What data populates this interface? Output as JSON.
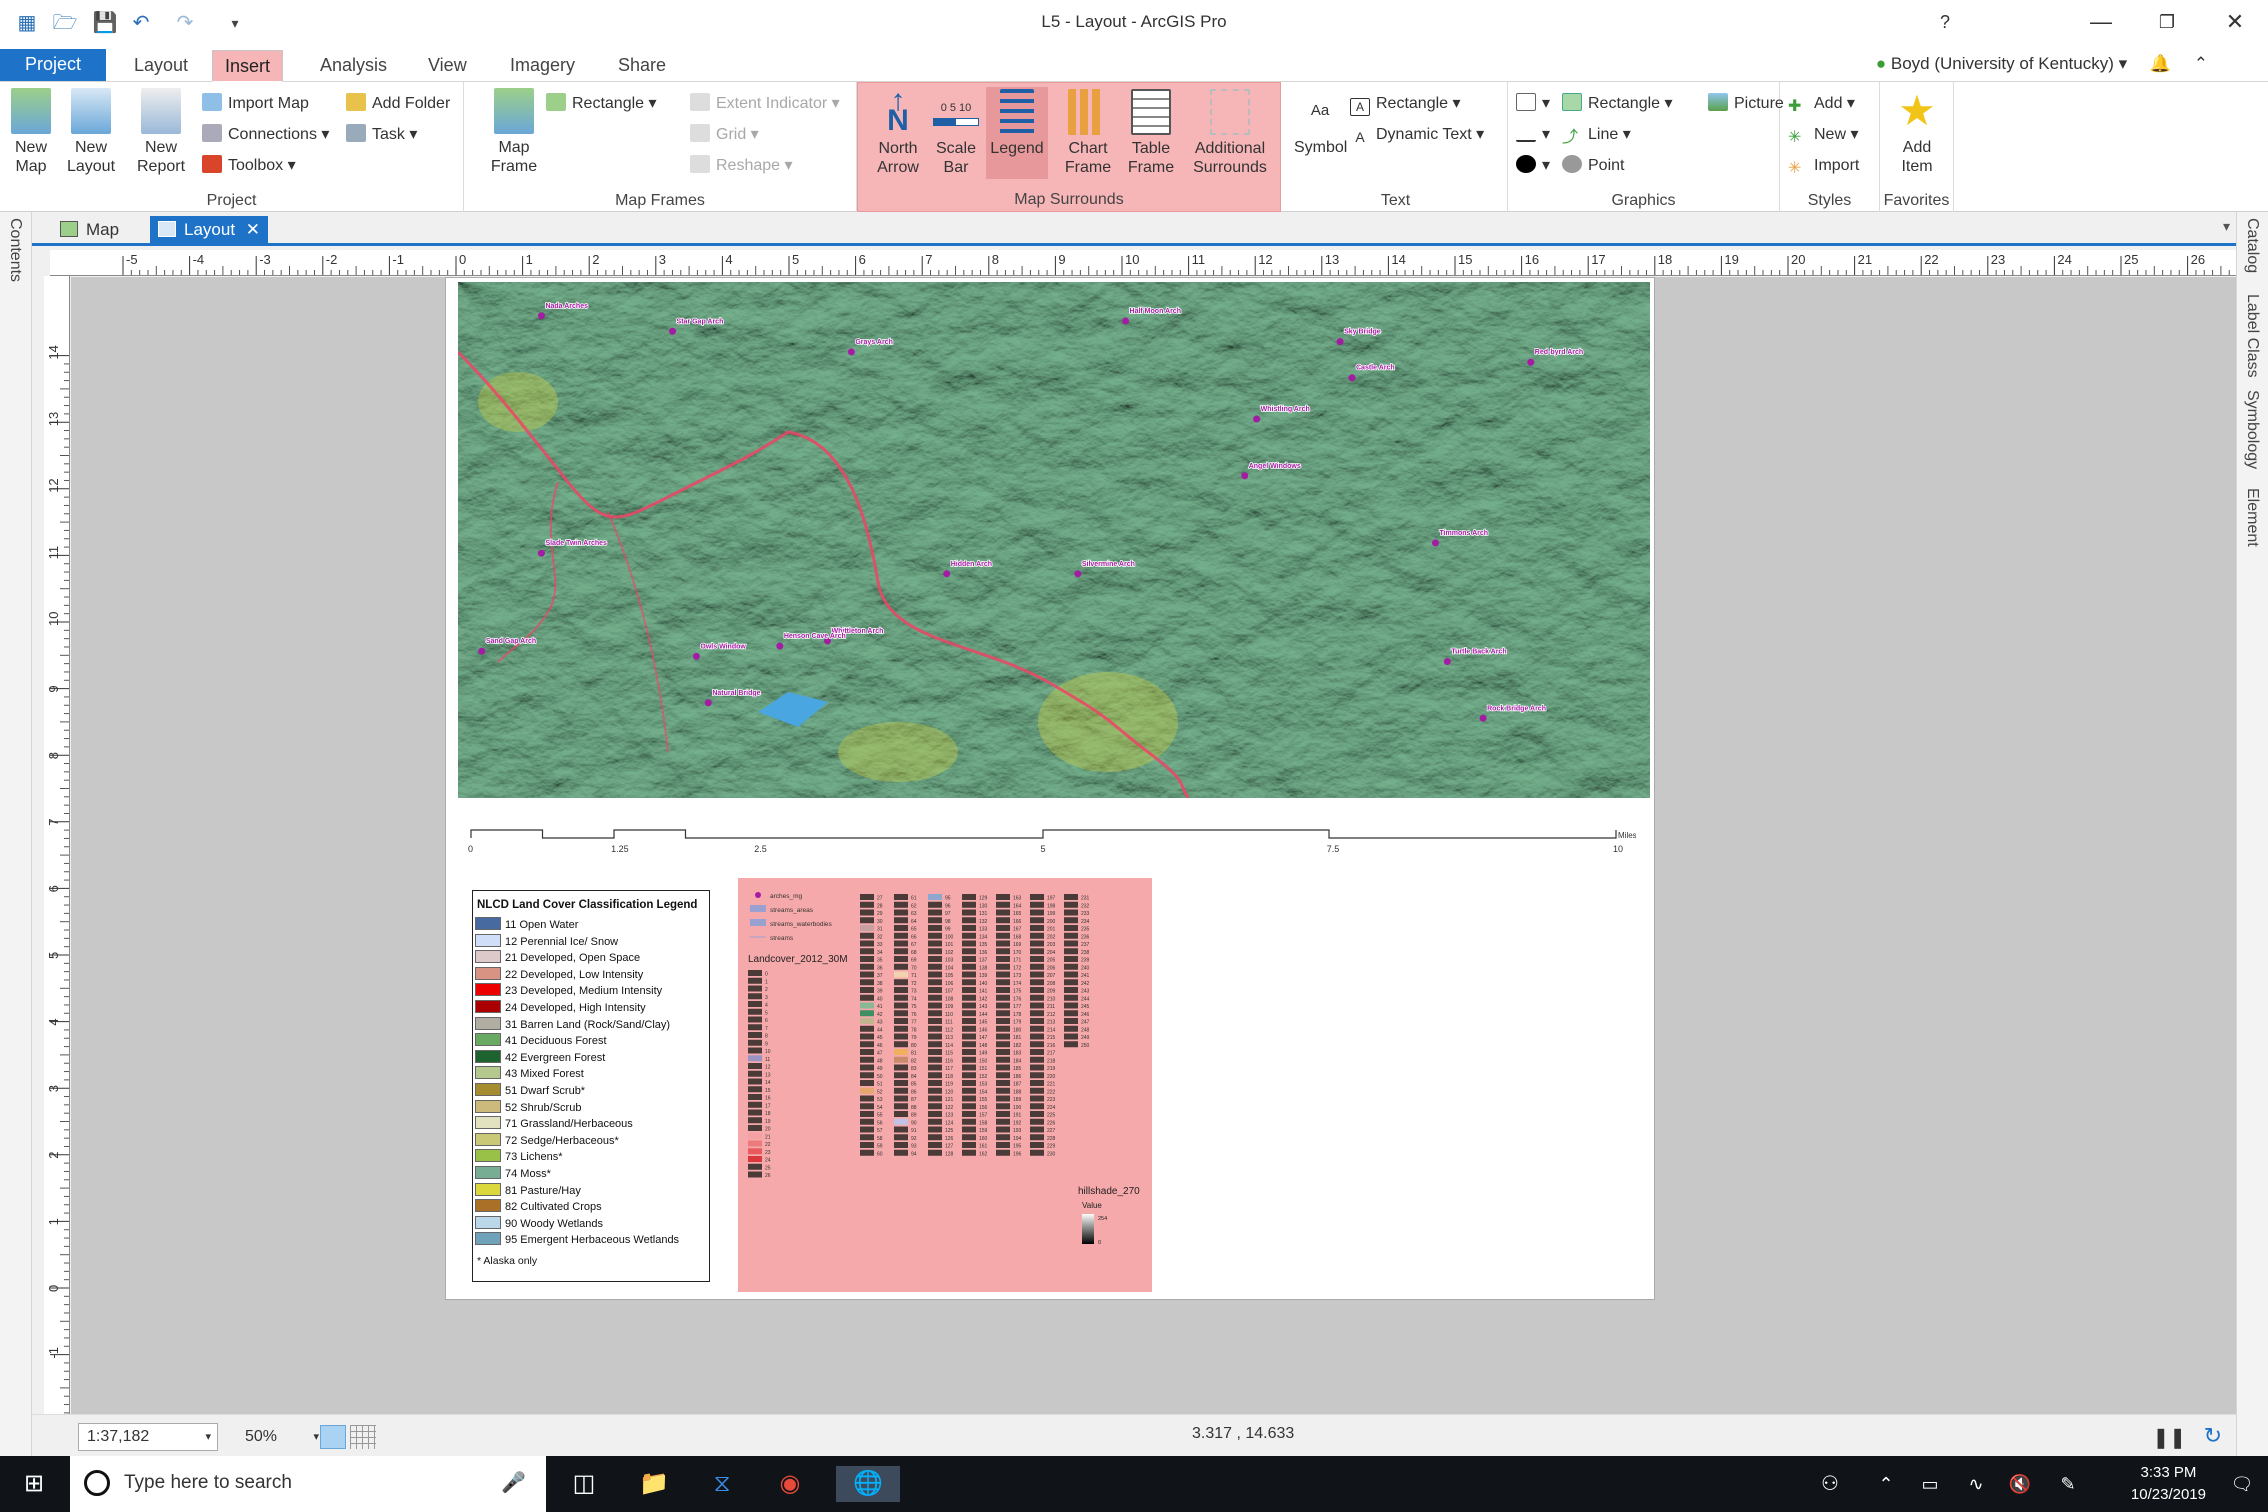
{
  "window": {
    "title": "L5 - Layout - ArcGIS Pro",
    "help": "?",
    "minimize": "—",
    "restore": "❐",
    "close": "✕"
  },
  "ribbon_tabs": [
    "Project",
    "Layout",
    "Insert",
    "Analysis",
    "View",
    "Imagery",
    "Share"
  ],
  "account": "Boyd (University of Kentucky)",
  "ribbon": {
    "project": {
      "label": "Project",
      "new_map": "New Map",
      "new_layout": "New Layout",
      "new_report": "New Report",
      "import_map": "Import Map",
      "connections": "Connections",
      "toolbox": "Toolbox",
      "add_folder": "Add Folder",
      "task": "Task"
    },
    "map_frames": {
      "label": "Map Frames",
      "map_frame": "Map Frame",
      "rectangle": "Rectangle",
      "extent_indicator": "Extent Indicator",
      "grid": "Grid",
      "reshape": "Reshape"
    },
    "map_surrounds": {
      "label": "Map Surrounds",
      "north_arrow": "North Arrow",
      "scale_bar": "Scale Bar",
      "scale_bar_ticks": "0 5 10",
      "legend": "Legend",
      "chart_frame": "Chart Frame",
      "table_frame": "Table Frame",
      "additional_surrounds": "Additional Surrounds"
    },
    "text": {
      "label": "Text",
      "symbol": "Symbol",
      "symbol_glyph": "Aa",
      "rectangle": "Rectangle",
      "dynamic_text": "Dynamic Text"
    },
    "graphics": {
      "label": "Graphics",
      "rectangle": "Rectangle",
      "line": "Line",
      "point": "Point",
      "picture": "Picture"
    },
    "styles": {
      "label": "Styles",
      "add": "Add",
      "new": "New",
      "import": "Import"
    },
    "favorites": {
      "label": "Favorites",
      "add_item": "Add Item"
    }
  },
  "docks": {
    "left": [
      "Contents"
    ],
    "right": [
      "Catalog",
      "Label Class",
      "Symbology",
      "Element"
    ]
  },
  "doc_tabs": [
    {
      "label": "Map"
    },
    {
      "label": "Layout"
    }
  ],
  "ruler": {
    "h_labels": [
      "-5",
      "-4",
      "-3",
      "-2",
      "-1",
      "0",
      "1",
      "2",
      "3",
      "4",
      "5",
      "6",
      "7",
      "8",
      "9",
      "10",
      "11",
      "12",
      "13",
      "14",
      "15",
      "16",
      "17",
      "18",
      "19",
      "20",
      "21",
      "22",
      "23",
      "24",
      "25",
      "26"
    ],
    "v_labels": [
      "14",
      "13",
      "12",
      "11",
      "10",
      "9",
      "8",
      "7",
      "6",
      "5",
      "4",
      "3",
      "2",
      "1",
      "0",
      "-1"
    ]
  },
  "map": {
    "arches": [
      "Nada Arches",
      "Star Gap Arch",
      "Grays Arch",
      "Half Moon Arch",
      "Sky Bridge",
      "Red-byrd Arch",
      "Castle Arch",
      "Whistling Arch",
      "Angel Windows",
      "Slade Twin Arches",
      "Hidden Arch",
      "Silvermine Arch",
      "Timmons Arch",
      "Sand Gap Arch",
      "Whittleton Arch",
      "Henson Cave Arch",
      "Owls Window",
      "Natural Bridge",
      "Turtle Back Arch",
      "Rock Bridge Arch"
    ]
  },
  "scalebar": {
    "labels": [
      "0",
      "1.25",
      "2.5",
      "5",
      "7.5",
      "10"
    ],
    "unit": "Miles"
  },
  "legend_nlcd": {
    "title": "NLCD Land Cover Classification Legend",
    "items": [
      {
        "label": "11 Open Water",
        "color": "#476ba0"
      },
      {
        "label": "12 Perennial Ice/ Snow",
        "color": "#d1def8"
      },
      {
        "label": "21 Developed, Open Space",
        "color": "#ddc9c9"
      },
      {
        "label": "22 Developed, Low Intensity",
        "color": "#d89382"
      },
      {
        "label": "23 Developed, Medium Intensity",
        "color": "#ed0000"
      },
      {
        "label": "24 Developed, High Intensity",
        "color": "#aa0000"
      },
      {
        "label": "31 Barren Land (Rock/Sand/Clay)",
        "color": "#b2ada3"
      },
      {
        "label": "41 Deciduous Forest",
        "color": "#68aa63"
      },
      {
        "label": "42 Evergreen Forest",
        "color": "#1c6330"
      },
      {
        "label": "43 Mixed Forest",
        "color": "#b5c98e"
      },
      {
        "label": "51 Dwarf Scrub*",
        "color": "#a58c30"
      },
      {
        "label": "52 Shrub/Scrub",
        "color": "#ccba7c"
      },
      {
        "label": "71 Grassland/Herbaceous",
        "color": "#e2e2c1"
      },
      {
        "label": "72 Sedge/Herbaceous*",
        "color": "#c9c977"
      },
      {
        "label": "73 Lichens*",
        "color": "#99c147"
      },
      {
        "label": "74 Moss*",
        "color": "#77ad93"
      },
      {
        "label": "81 Pasture/Hay",
        "color": "#dbd83d"
      },
      {
        "label": "82 Cultivated Crops",
        "color": "#ab7028"
      },
      {
        "label": "90 Woody Wetlands",
        "color": "#bad8ea"
      },
      {
        "label": "95 Emergent Herbaceous Wetlands",
        "color": "#70a3ba"
      }
    ],
    "note": "* Alaska only"
  },
  "legend_default": {
    "layers": [
      "arches_mg",
      "streams_areas",
      "streams_waterbodies",
      "streams"
    ],
    "raster_title": "Landcover_2012_30M",
    "hillshade_title": "hillshade_270",
    "hillshade_value_label": "Value",
    "hillshade_high": "254",
    "hillshade_low": "0"
  },
  "statusbar": {
    "scale": "1:37,182",
    "zoom": "50%",
    "coords": "3.317 , 14.633"
  },
  "taskbar": {
    "search_placeholder": "Type here to search",
    "time": "3:33 PM",
    "date": "10/23/2019"
  },
  "colors": {
    "accent": "#1e73c9",
    "selection_pink": "#f6b6b8",
    "arch_marker": "#a31ca3",
    "road": "#ee4466"
  }
}
